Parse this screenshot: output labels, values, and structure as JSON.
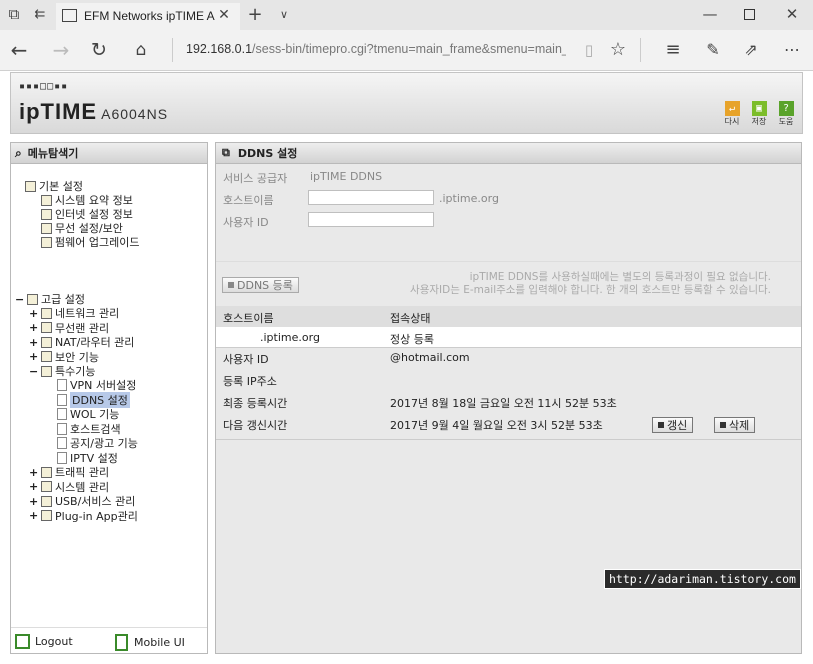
{
  "browser": {
    "tab_title": "EFM Networks ipTIME A",
    "url_host": "192.168.0.1",
    "url_rest": "/sess-bin/timepro.cgi?tmenu=main_frame&smenu=main_fran"
  },
  "header": {
    "brand": "ipTIME",
    "model": "A6004NS",
    "buttons": [
      {
        "label": "다시",
        "color": "#e7a32a",
        "icon": "refresh-icon"
      },
      {
        "label": "저장",
        "color": "#7cbd2a",
        "icon": "save-icon"
      },
      {
        "label": "도움",
        "color": "#5aa32b",
        "icon": "help-icon"
      }
    ]
  },
  "sidebar": {
    "title": "메뉴탐색기",
    "basic": {
      "label": "기본 설정",
      "items": [
        "시스템 요약 정보",
        "인터넷 설정 정보",
        "무선 설정/보안",
        "펌웨어 업그레이드"
      ]
    },
    "advanced": {
      "label": "고급 설정",
      "items": [
        "네트워크 관리",
        "무선랜 관리",
        "NAT/라우터 관리",
        "보안 기능"
      ],
      "special": {
        "label": "특수기능",
        "items": [
          "VPN 서버설정",
          "DDNS 설정",
          "WOL 기능",
          "호스트검색",
          "공지/광고 기능",
          "IPTV 설정"
        ],
        "selected": "DDNS 설정"
      },
      "more": [
        "트래픽 관리",
        "시스템 관리",
        "USB/서비스 관리",
        "Plug-in App관리"
      ]
    },
    "logout": "Logout",
    "mobile": "Mobile UI"
  },
  "ddns": {
    "title": "DDNS 설정",
    "provider_label": "서비스 공급자",
    "provider_value": "ipTIME DDNS",
    "host_label": "호스트이름",
    "host_suffix": ".iptime.org",
    "user_label": "사용자 ID",
    "register_button": "DDNS 등록",
    "notice_line1": "ipTIME DDNS를 사용하실때에는 별도의 등록과정이 필요 없습니다.",
    "notice_line2": "사용자ID는 E-mail주소를 입력해야 합니다. 한 개의 호스트만 등록할 수 있습니다.",
    "table": {
      "col_host": "호스트이름",
      "col_status": "접속상태",
      "row_host": ".iptime.org",
      "row_status": "정상 등록"
    },
    "details": [
      {
        "label": "사용자 ID",
        "value": "@hotmail.com"
      },
      {
        "label": "등록 IP주소",
        "value": ""
      },
      {
        "label": "최종 등록시간",
        "value": "2017년 8월 18일 금요일 오전 11시 52분 53초"
      },
      {
        "label": "다음 갱신시간",
        "value": "2017년 9월 4일 월요일 오전 3시 52분 53초"
      }
    ],
    "renew_button": "갱신",
    "delete_button": "삭제"
  },
  "watermark": "http://adariman.tistory.com"
}
